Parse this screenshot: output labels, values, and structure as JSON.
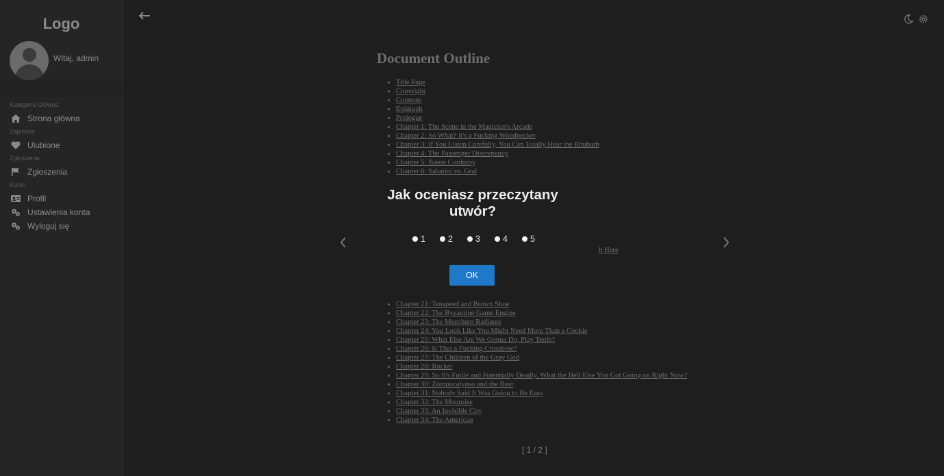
{
  "sidebar": {
    "logo": "Logo",
    "greeting": "Witaj, admin",
    "sections": [
      {
        "label": "Kategorie Główne",
        "items": [
          {
            "label": "Strona główna",
            "icon": "home-icon"
          }
        ]
      },
      {
        "label": "Zapisane",
        "items": [
          {
            "label": "Ulubione",
            "icon": "heart-icon"
          }
        ]
      },
      {
        "label": "Zgłoszenia",
        "items": [
          {
            "label": "Zgłoszenia",
            "icon": "flag-icon"
          }
        ]
      },
      {
        "label": "Konto",
        "items": [
          {
            "label": "Profil",
            "icon": "id-card-icon"
          },
          {
            "label": "Ustawienia konta",
            "icon": "gears-icon"
          },
          {
            "label": "Wyloguj się",
            "icon": "gears-icon"
          }
        ]
      }
    ]
  },
  "document": {
    "title": "Document Outline",
    "outline_top": [
      "Title Page",
      "Copyright",
      "Contents",
      "Epigraph",
      "Prologue",
      "Chapter 1: The Scene in the Magician's Arcade",
      "Chapter 2: So What? It's a Fucking Woodpecker",
      "Chapter 3: If You Listen Carefully, You Can Totally Hear the Rhubarb",
      "Chapter 4: The Passenger Discrepancy",
      "Chapter 5: Baron Corduroy",
      "Chapter 6: Sabatini vs. Graf"
    ],
    "fragment": "h Here",
    "outline_bottom": [
      "Chapter 21: Tenspeed and Brown Shoe",
      "Chapter 22: The Byzantine Game Engine",
      "Chapter 23: The Meechum Radiants",
      "Chapter 24: You Look Like You Might Need More Than a Cookie",
      "Chapter 25: What Else Are We Gonna Do, Play Tetris?",
      "Chapter 26: Is That a Fucking Crossbow?",
      "Chapter 27: The Children of the Gray God",
      "Chapter 28: Rocket",
      "Chapter 29: So It's Futile and Potentially Deadly. What the Hell Else You Got Going on Right Now?",
      "Chapter 30: Zompocalypso and the Bear",
      "Chapter 31: Nobody Said It Was Going to Be Easy",
      "Chapter 32: The Moonrise",
      "Chapter 33: An Invisible City",
      "Chapter 34: The American"
    ],
    "pager": "[ 1 / 2 ]"
  },
  "modal": {
    "question": "Jak oceniasz przeczytany utwór?",
    "options": [
      "1",
      "2",
      "3",
      "4",
      "5"
    ],
    "ok_label": "OK",
    "accent": "#1f78c8"
  }
}
